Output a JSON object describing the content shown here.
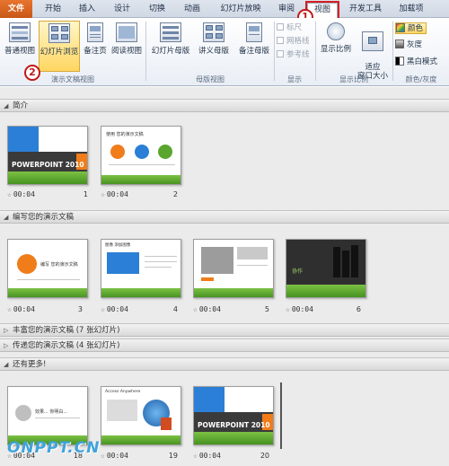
{
  "ribbon_tabs": [
    {
      "label": "文件"
    },
    {
      "label": "开始"
    },
    {
      "label": "插入"
    },
    {
      "label": "设计"
    },
    {
      "label": "切换"
    },
    {
      "label": "动画"
    },
    {
      "label": "幻灯片放映"
    },
    {
      "label": "审阅"
    },
    {
      "label": "视图"
    },
    {
      "label": "开发工具"
    },
    {
      "label": "加载项"
    }
  ],
  "groups": {
    "presentation_views": {
      "label": "演示文稿视图",
      "buttons": [
        "普通视图",
        "幻灯片浏览",
        "备注页",
        "阅读视图"
      ]
    },
    "master_views": {
      "label": "母版视图",
      "buttons": [
        "幻灯片母版",
        "讲义母版",
        "备注母版"
      ]
    },
    "show": {
      "label": "显示",
      "items": [
        "标尺",
        "网格线",
        "参考线"
      ]
    },
    "zoom": {
      "label": "显示比例",
      "buttons": [
        "显示比例",
        "适应\n窗口大小"
      ]
    },
    "color": {
      "label": "颜色/灰度",
      "items": [
        "颜色",
        "灰度",
        "黑白模式"
      ]
    }
  },
  "annotations": [
    "1",
    "2"
  ],
  "sections": [
    {
      "title": "简介",
      "expanded": true
    },
    {
      "title": "编写您的演示文稿",
      "expanded": true
    },
    {
      "title": "丰富您的演示文稿 (7 张幻灯片)",
      "expanded": false
    },
    {
      "title": "传递您的演示文稿 (4 张幻灯片)",
      "expanded": false
    },
    {
      "title": "还有更多!",
      "expanded": true
    }
  ],
  "slides": [
    {
      "number": "1",
      "time": "00:04",
      "title_text": "POWERPOINT 2010"
    },
    {
      "number": "2",
      "time": "00:04",
      "title_text": "使用 您的演示文稿"
    },
    {
      "number": "3",
      "time": "00:04",
      "title_text": "编写 您的演示文稿"
    },
    {
      "number": "4",
      "time": "00:04",
      "title_text": "图像 添加图像"
    },
    {
      "number": "5",
      "time": "00:04",
      "title_text": ""
    },
    {
      "number": "6",
      "time": "00:04",
      "title_text": "协作"
    },
    {
      "number": "18",
      "time": "00:04",
      "title_text": "效果... 你明白..."
    },
    {
      "number": "19",
      "time": "00:04",
      "title_text": "Access Anywhere"
    },
    {
      "number": "20",
      "time": "00:04",
      "title_text": "POWERPOINT 2010"
    }
  ],
  "watermark": "ONPPT.CN",
  "colors": {
    "file_tab": "#d0631f",
    "accent_blue": "#2b7fd6",
    "accent_orange": "#f07c1a",
    "accent_green": "#5aa52e",
    "highlight_red": "#c01818"
  }
}
